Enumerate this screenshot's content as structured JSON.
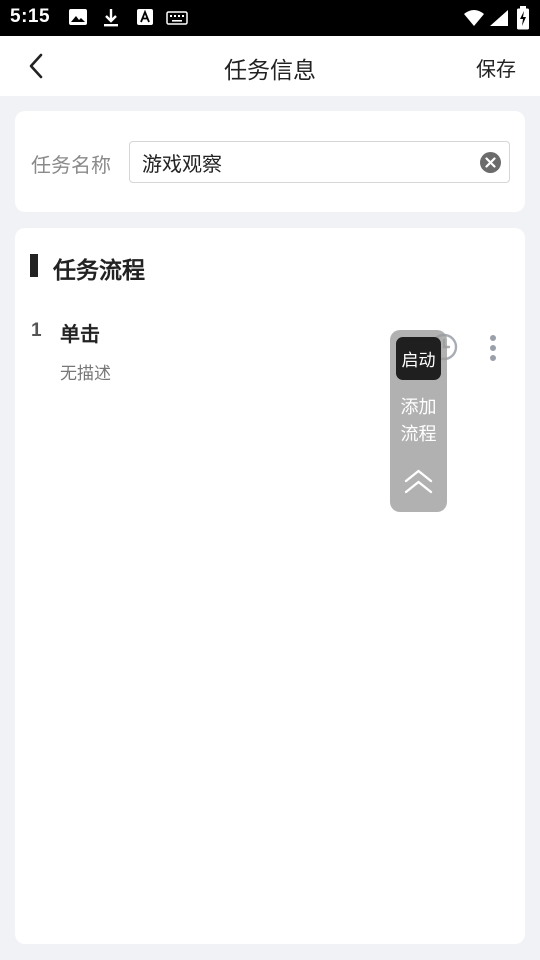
{
  "status_bar": {
    "time": "5:15",
    "left_icons": [
      "image-icon",
      "download-icon",
      "font-icon",
      "keyboard-icon"
    ],
    "right_icons": [
      "wifi-icon",
      "signal-icon",
      "battery-charging-icon"
    ]
  },
  "app_bar": {
    "title": "任务信息",
    "save_label": "保存",
    "back_icon": "chevron-left-icon"
  },
  "task_name": {
    "label": "任务名称",
    "value": "游戏观察",
    "clear_icon": "clear-circle-icon"
  },
  "flow": {
    "section_title": "任务流程",
    "steps": [
      {
        "index": "1",
        "title": "单击",
        "description": "无描述",
        "timer_icon": "timer-icon",
        "more_icon": "more-vertical-icon"
      }
    ]
  },
  "float_panel": {
    "start_label": "启动",
    "add_flow_label_line1": "添加",
    "add_flow_label_line2": "流程",
    "collapse_icon": "double-chevron-up-icon"
  },
  "colors": {
    "page_background": "#f1f2f6",
    "card_background": "#ffffff",
    "status_bar": "#000000",
    "start_button": "#1f1f1f",
    "panel": "#9b9b9b"
  }
}
